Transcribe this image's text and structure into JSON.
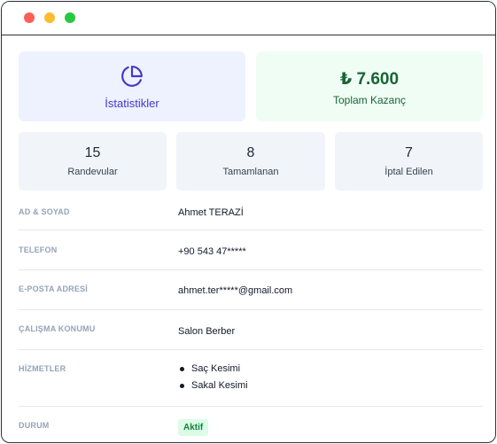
{
  "window": {
    "controls": [
      "close",
      "minimize",
      "maximize"
    ]
  },
  "stats_card": {
    "label": "İstatistikler",
    "icon": "pie-chart-icon"
  },
  "earnings_card": {
    "amount": "₺ 7.600",
    "label": "Toplam Kazanç"
  },
  "metrics": [
    {
      "value": "15",
      "label": "Randevular"
    },
    {
      "value": "8",
      "label": "Tamamlanan"
    },
    {
      "value": "7",
      "label": "İptal Edilen"
    }
  ],
  "profile": {
    "name_label": "AD & SOYAD",
    "name": "Ahmet TERAZİ",
    "phone_label": "TELEFON",
    "phone": "+90 543 47*****",
    "email_label": "E-POSTA ADRESİ",
    "email": "ahmet.ter*****@gmail.com",
    "location_label": "ÇALIŞMA KONUMU",
    "location": "Salon Berber",
    "services_label": "HİZMETLER",
    "services": [
      "Saç Kesimi",
      "Sakal Kesimi"
    ],
    "status_label": "DURUM",
    "status": "Aktif"
  },
  "colors": {
    "stats_bg": "#eef2ff",
    "stats_accent": "#4338ca",
    "earnings_bg": "#f0fdf4",
    "earnings_accent": "#166534",
    "status_badge_bg": "#dcfce7",
    "status_badge_text": "#15803d"
  }
}
